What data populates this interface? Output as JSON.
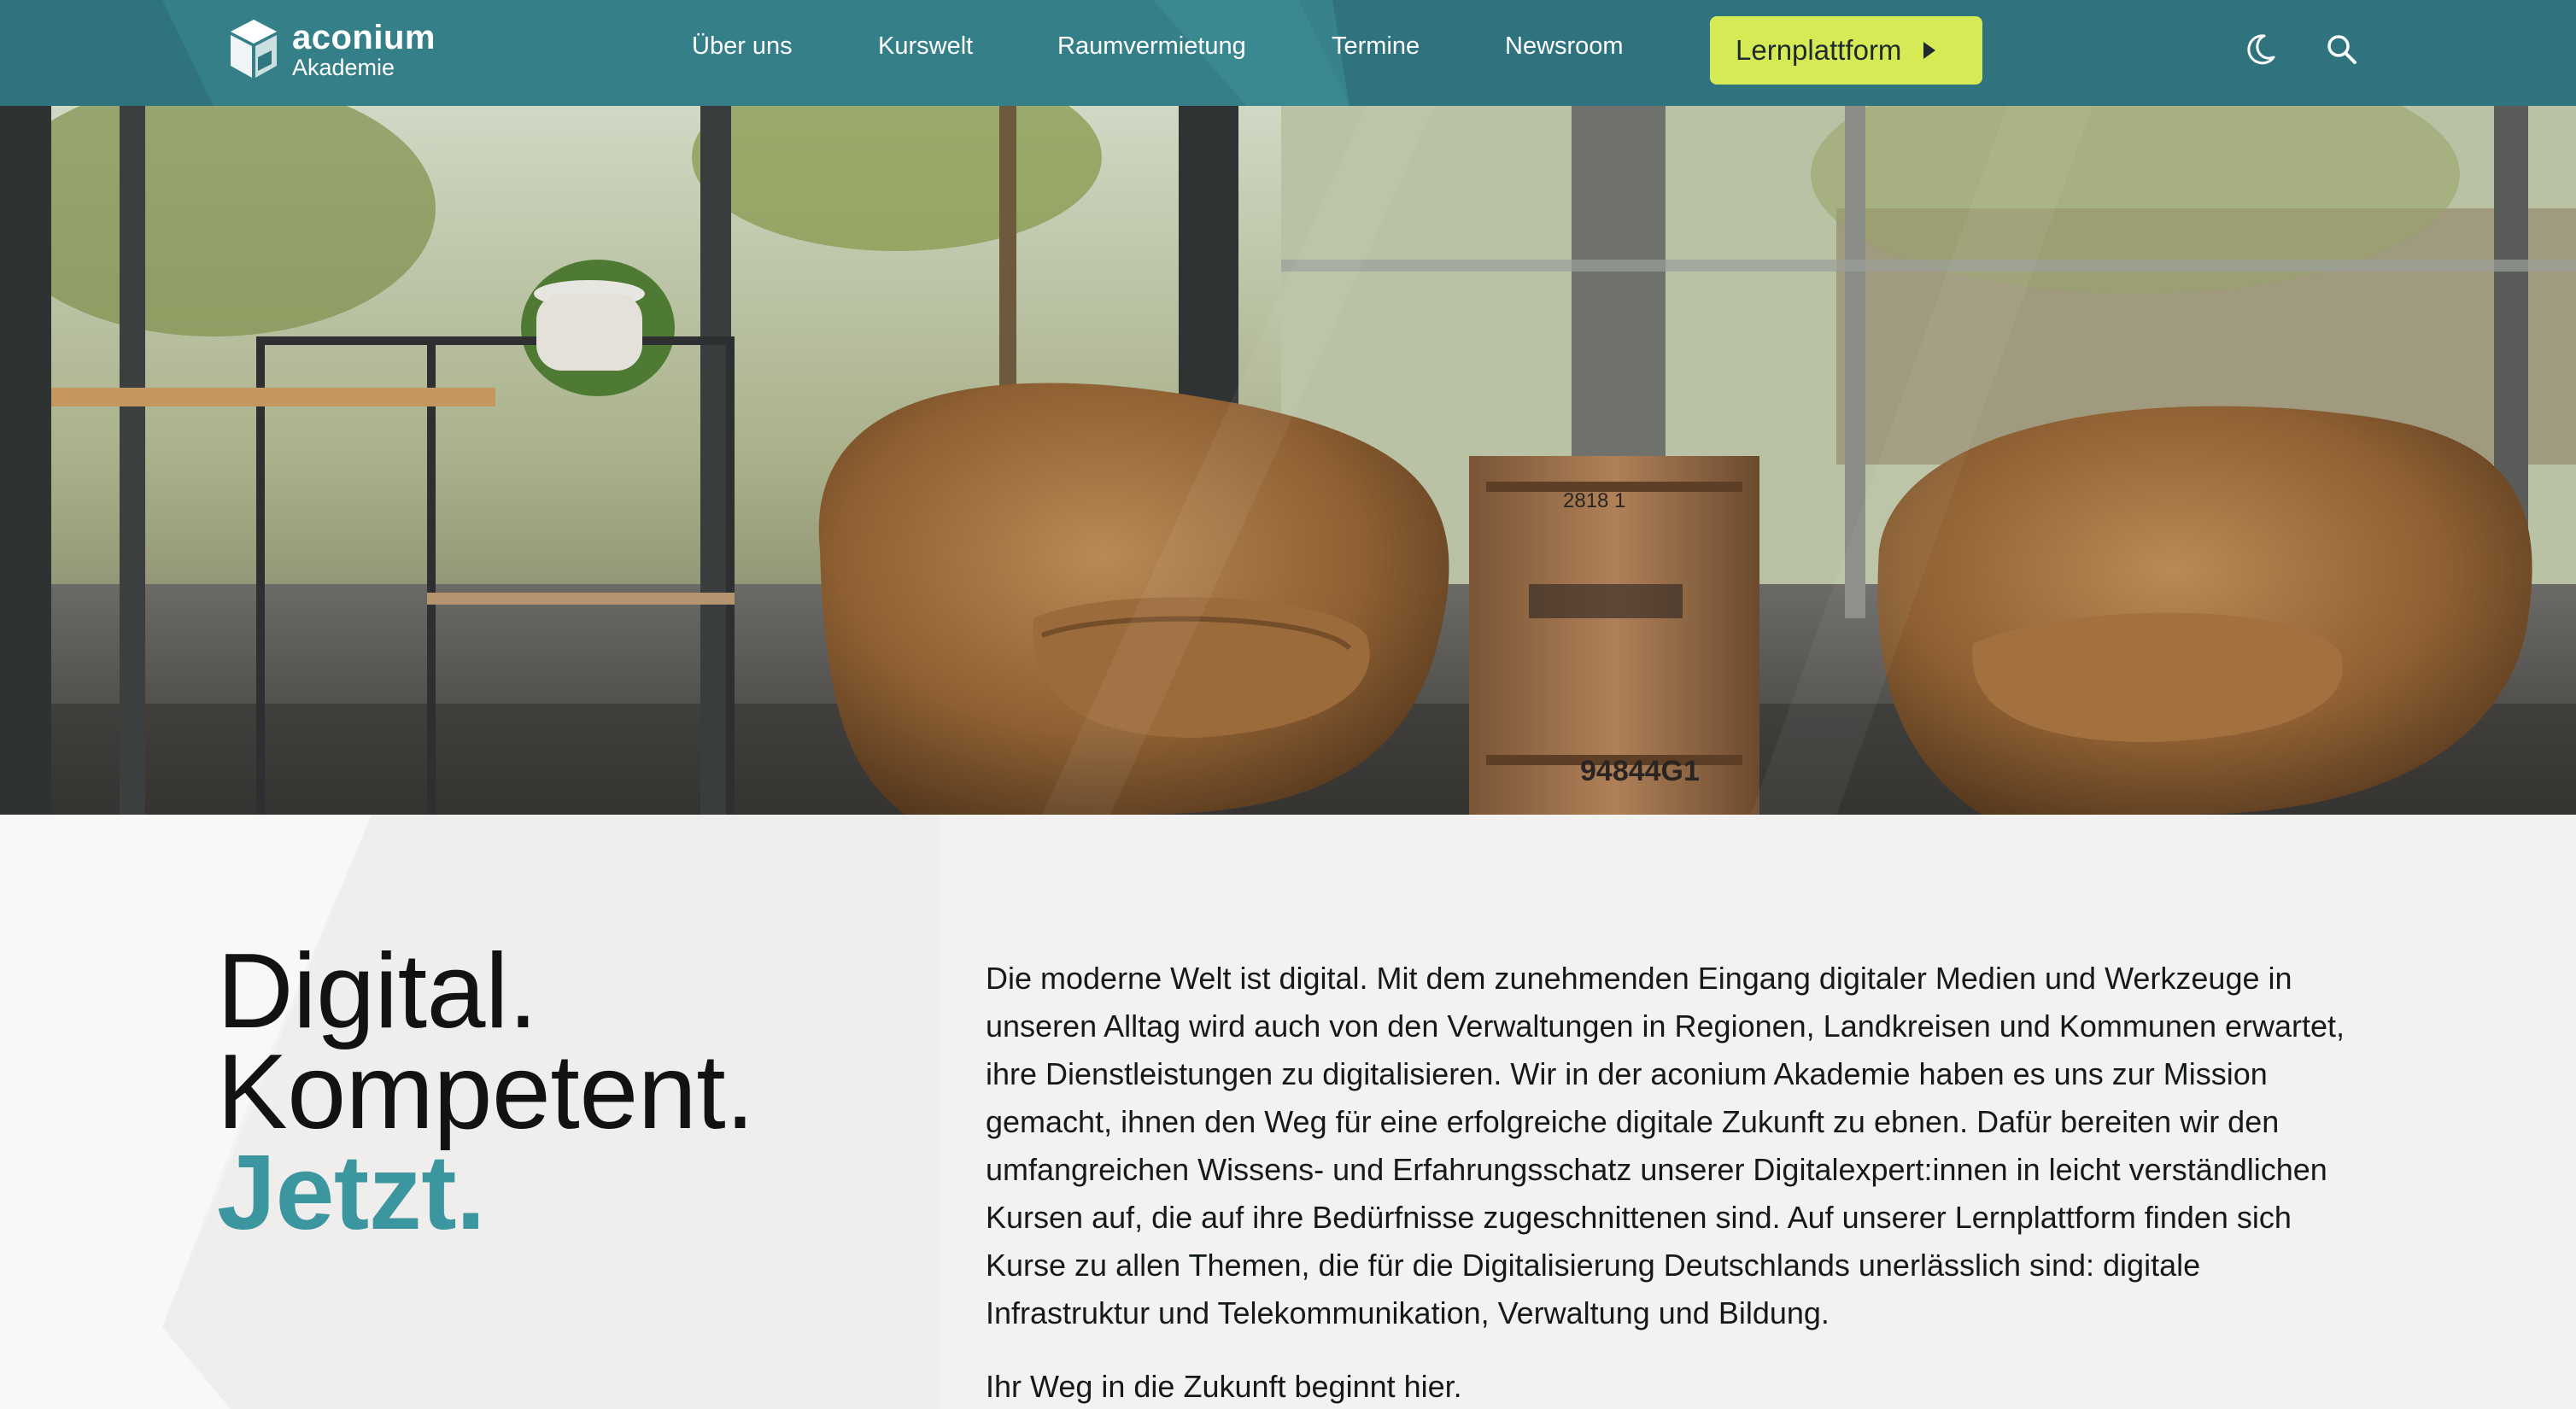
{
  "brand": {
    "name": "aconium",
    "subtitle": "Akademie"
  },
  "nav": {
    "items": [
      "Über uns",
      "Kurswelt",
      "Raumvermietung",
      "Termine",
      "Newsroom"
    ],
    "cta_label": "Lernplattform"
  },
  "icons": {
    "theme_toggle": "moon-icon",
    "search": "search-icon",
    "cta": "play-triangle-icon",
    "logo": "cube-logo-icon"
  },
  "colors": {
    "header": "#2f7681",
    "cta": "#d6ea56",
    "accent": "#3c96a0",
    "text": "#101214"
  },
  "hero": {
    "crate_label_top": "2818 1",
    "crate_label_bottom": "94844G1"
  },
  "headline": {
    "line1": "Digital.",
    "line2": "Kompetent.",
    "line3": "Jetzt."
  },
  "intro": {
    "paragraph": "Die moderne Welt ist digital. Mit dem zunehmenden Eingang digitaler Medien und Werkzeuge in unseren Alltag wird auch von den Verwaltungen in Regionen, Landkreisen und Kommunen erwartet, ihre Dienstleistungen zu digitalisieren. Wir in der aconium Akademie haben es uns zur Mission gemacht, ihnen den Weg für eine erfolgreiche digitale Zukunft zu ebnen. Dafür bereiten wir den umfangreichen Wissens- und Erfahrungsschatz unserer Digitalexpert:innen in leicht verständlichen Kursen auf, die auf ihre Bedürfnisse zugeschnittenen sind. Auf unserer Lernplattform finden sich Kurse zu allen Themen, die für die Digitalisierung Deutschlands unerlässlich sind: digitale Infrastruktur und Telekommunikation, Verwaltung und Bildung.",
    "tagline": "Ihr Weg in die Zukunft beginnt hier."
  }
}
